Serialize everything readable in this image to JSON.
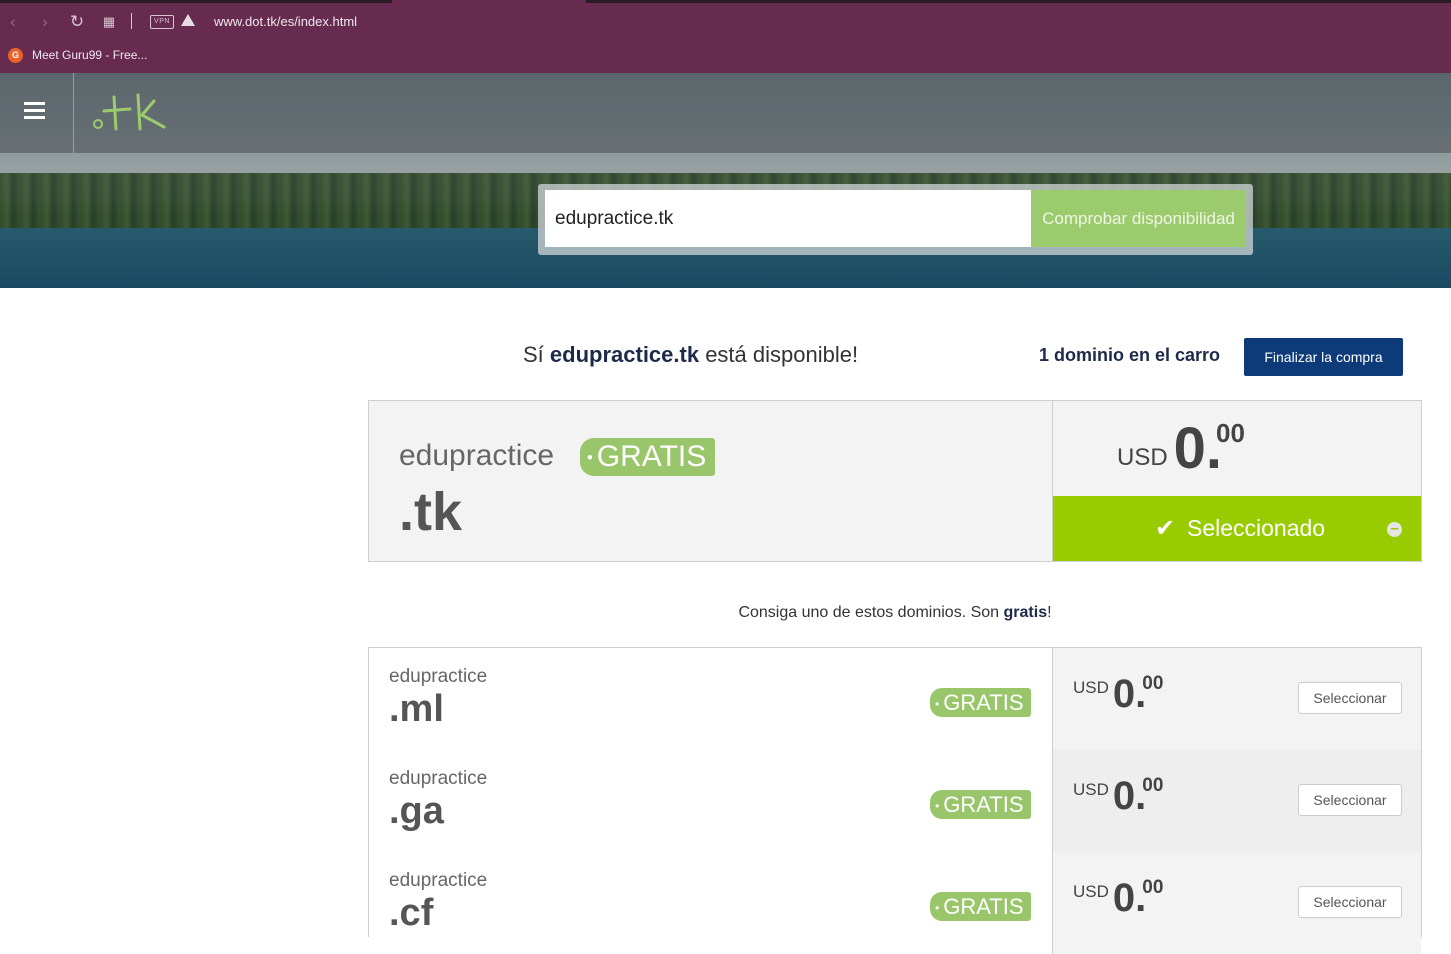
{
  "browser": {
    "url": "www.dot.tk/es/index.html",
    "vpn_label": "VPN",
    "bookmark_icon_letter": "G",
    "bookmark_label": "Meet Guru99 - Free...",
    "theme_color": "#662b4f"
  },
  "header": {
    "menu_icon": "hamburger-icon",
    "logo_icon": "dot-tk-logo"
  },
  "search": {
    "value": "edupractice.tk",
    "button_label": "Comprobar disponibilidad"
  },
  "availability": {
    "prefix": "Sí ",
    "domain": "edupractice.tk",
    "suffix": " está disponible!",
    "cart_text": "1 dominio en el carro",
    "checkout_label": "Finalizar la compra"
  },
  "main_offer": {
    "name": "edupractice",
    "tld": ".tk",
    "badge_dot": "•",
    "badge": "GRATIS",
    "currency": "USD",
    "price_int": "0.",
    "price_dec": "00",
    "status_label": "Seleccionado",
    "status_icon": "check-icon",
    "remove_icon": "minus-circle-icon",
    "accent_color": "#99cc00"
  },
  "alternatives": {
    "intro_prefix": "Consiga uno de estos dominios. Son ",
    "intro_bold": "gratis",
    "intro_suffix": "!",
    "items": [
      {
        "name": "edupractice",
        "tld": ".ml",
        "badge_dot": "•",
        "badge": "GRATIS",
        "currency": "USD",
        "price_int": "0.",
        "price_dec": "00",
        "button": "Seleccionar"
      },
      {
        "name": "edupractice",
        "tld": ".ga",
        "badge_dot": "•",
        "badge": "GRATIS",
        "currency": "USD",
        "price_int": "0.",
        "price_dec": "00",
        "button": "Seleccionar"
      },
      {
        "name": "edupractice",
        "tld": ".cf",
        "badge_dot": "•",
        "badge": "GRATIS",
        "currency": "USD",
        "price_int": "0.",
        "price_dec": "00",
        "button": "Seleccionar"
      }
    ]
  }
}
